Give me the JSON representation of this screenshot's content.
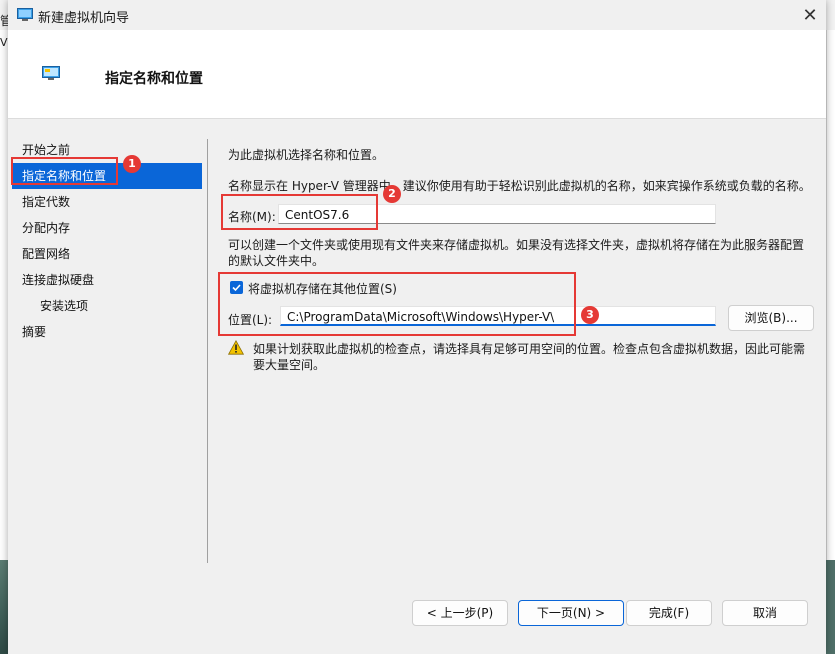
{
  "window": {
    "title": "新建虚拟机向导",
    "close_symbol": "✕"
  },
  "header": {
    "title": "指定名称和位置"
  },
  "steps": [
    {
      "label": "开始之前"
    },
    {
      "label": "指定名称和位置"
    },
    {
      "label": "指定代数"
    },
    {
      "label": "分配内存"
    },
    {
      "label": "配置网络"
    },
    {
      "label": "连接虚拟硬盘"
    },
    {
      "label": "安装选项"
    },
    {
      "label": "摘要"
    }
  ],
  "content": {
    "intro": "为此虚拟机选择名称和位置。",
    "name_desc": "名称显示在 Hyper-V 管理器中。建议你使用有助于轻松识别此虚拟机的名称，如来宾操作系统或负载的名称。",
    "name_label": "名称(M):",
    "name_value": "CentOS7.6",
    "folder_desc": "可以创建一个文件夹或使用现有文件夹来存储虚拟机。如果没有选择文件夹，虚拟机将存储在为此服务器配置的默认文件夹中。",
    "store_checkbox_label": "将虚拟机存储在其他位置(S)",
    "store_checkbox_checked": true,
    "location_label": "位置(L):",
    "location_value": "C:\\ProgramData\\Microsoft\\Windows\\Hyper-V\\",
    "browse_label": "浏览(B)...",
    "warning_text": "如果计划获取此虚拟机的检查点，请选择具有足够可用空间的位置。检查点包含虚拟机数据，因此可能需要大量空间。"
  },
  "footer": {
    "prev_label": "< 上一步(P)",
    "next_label": "下一页(N) >",
    "finish_label": "完成(F)",
    "cancel_label": "取消"
  },
  "annotations": {
    "badge1": "1",
    "badge2": "2",
    "badge3": "3"
  },
  "background": {
    "glyph1": "管",
    "glyph2": "V"
  },
  "colors": {
    "accent": "#0a66d8",
    "annotation_red": "#e53935",
    "warning_yellow": "#f2c200"
  }
}
